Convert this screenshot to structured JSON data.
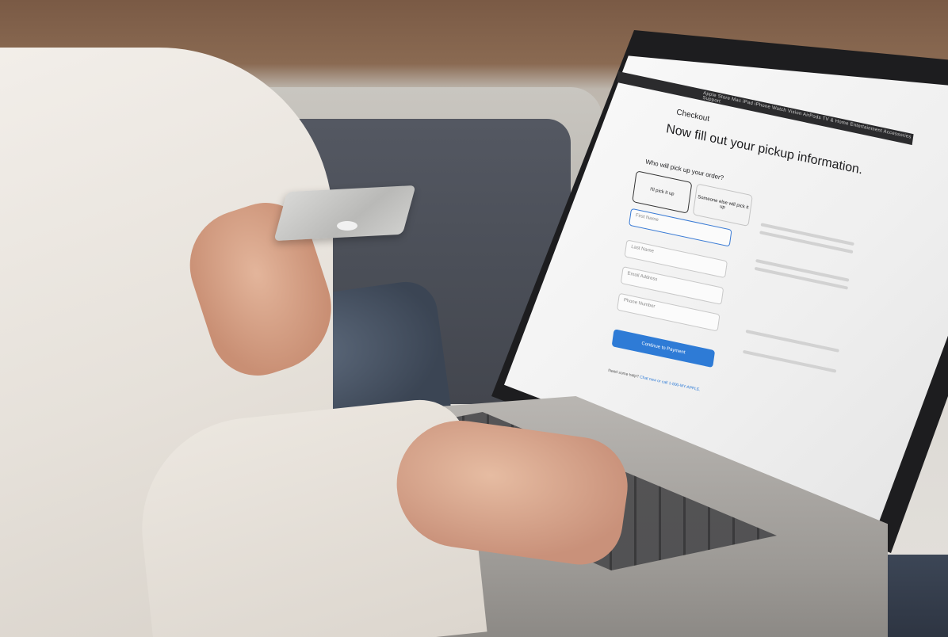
{
  "scene": {
    "description_colors": {
      "screen_accent": "#2e7bd6",
      "sofa": "#4b4f58",
      "sweater": "#ece7e0",
      "laptop": "#a9a6a2"
    }
  },
  "screen": {
    "nav": "Apple  Store  Mac  iPad  iPhone  Watch  Vision  AirPods  TV & Home  Entertainment  Accessories  Support",
    "page_label": "Checkout",
    "heading": "Now fill out your pickup information.",
    "question": "Who will pick up your order?",
    "option_self": "I'll pick it up",
    "option_other": "Someone else will pick it up",
    "fields": {
      "first_name": "First Name",
      "last_name": "Last Name",
      "email": "Email Address",
      "phone": "Phone Number"
    },
    "continue_button": "Continue to Payment",
    "help_text": "Need some help?",
    "help_link": "Chat now or call 1-800-MY-APPLE."
  }
}
